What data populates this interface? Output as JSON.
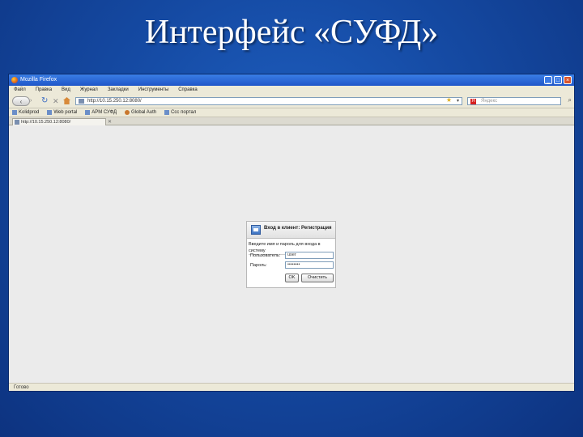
{
  "slide": {
    "title": "Интерфейс «СУФД»"
  },
  "browser": {
    "window_title": "Mozilla Firefox",
    "menu": [
      "Файл",
      "Правка",
      "Вид",
      "Журнал",
      "Закладки",
      "Инструменты",
      "Справка"
    ],
    "url": "http://10.15.250.12:8080/",
    "search_placeholder": "Яндекс",
    "search_logo": "Я",
    "bookmarks": [
      {
        "label": "Kolidprod",
        "icon": "page-icon"
      },
      {
        "label": "Web portal",
        "icon": "page-icon"
      },
      {
        "label": "АРМ СУФД",
        "icon": "page-icon"
      },
      {
        "label": "Global Auth",
        "icon": "firefox-icon"
      },
      {
        "label": "Ссс портал",
        "icon": "page-icon"
      }
    ],
    "tab_label": "http://10.15.250.12:8080/",
    "status": "Готово"
  },
  "dialog": {
    "title": "Вход в клиент: Регистрация",
    "prompt": "Введите имя и пароль для входа в систему",
    "user_label": "Пользователь:",
    "user_value": "user",
    "password_label": "Пароль:",
    "password_value": "••••••••",
    "ok_label": "OK",
    "clear_label": "Очистить"
  }
}
